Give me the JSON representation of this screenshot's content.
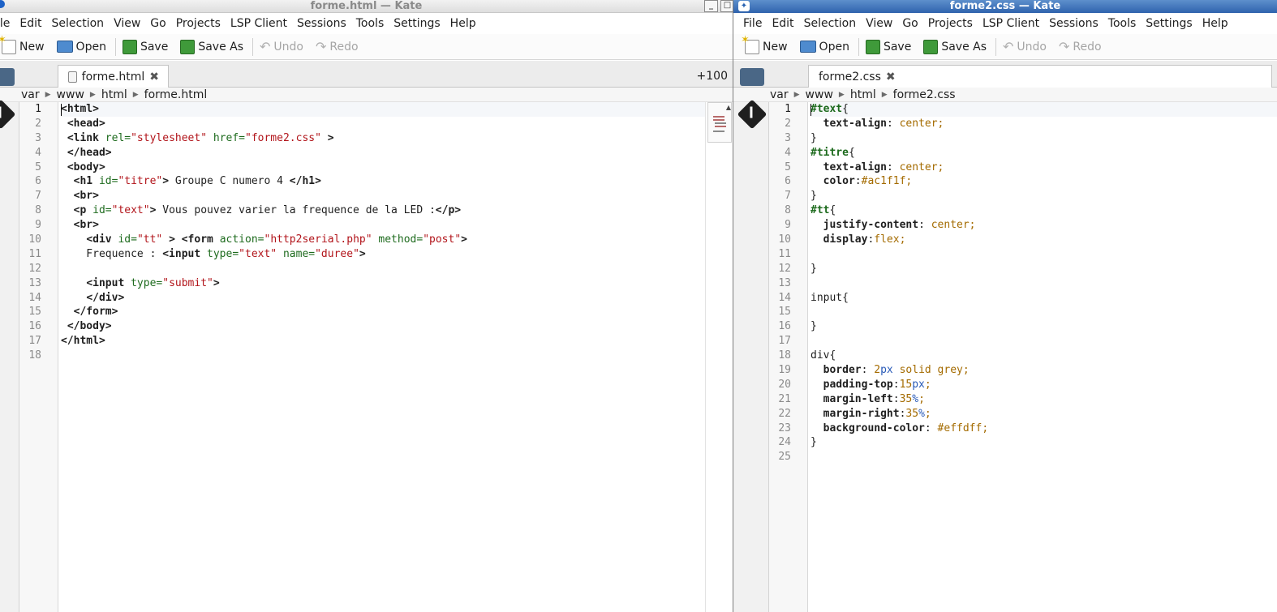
{
  "colors": {
    "tag": "#1f1f1f",
    "attr": "#1e6b1e",
    "string": "#b2151b",
    "value": "#a46b00",
    "number": "#2a5bb8",
    "selector": "#1e6b1e"
  },
  "left": {
    "title": "forme.html  — Kate",
    "menu": [
      "ile",
      "Edit",
      "Selection",
      "View",
      "Go",
      "Projects",
      "LSP Client",
      "Sessions",
      "Tools",
      "Settings",
      "Help"
    ],
    "toolbar": {
      "new": "New",
      "open": "Open",
      "save": "Save",
      "save_as": "Save As",
      "undo": "Undo",
      "redo": "Redo"
    },
    "tab": {
      "label": "forme.html",
      "close": "✖"
    },
    "zoom": "+100",
    "breadcrumb": [
      "var",
      "www",
      "html",
      "forme.html"
    ],
    "lines": [
      {
        "n": "1",
        "segs": [
          {
            "t": "<html>",
            "c": "tag"
          }
        ]
      },
      {
        "n": "2",
        "segs": [
          {
            "t": " "
          },
          {
            "t": "<head>",
            "c": "tag"
          }
        ]
      },
      {
        "n": "3",
        "segs": [
          {
            "t": " "
          },
          {
            "t": "<link",
            "c": "tag"
          },
          {
            "t": " "
          },
          {
            "t": "rel=",
            "c": "attr"
          },
          {
            "t": "\"stylesheet\"",
            "c": "string"
          },
          {
            "t": " "
          },
          {
            "t": "href=",
            "c": "attr"
          },
          {
            "t": "\"forme2.css\"",
            "c": "string"
          },
          {
            "t": " "
          },
          {
            "t": ">",
            "c": "tag"
          }
        ]
      },
      {
        "n": "4",
        "segs": [
          {
            "t": " "
          },
          {
            "t": "</head>",
            "c": "tag"
          }
        ]
      },
      {
        "n": "5",
        "segs": [
          {
            "t": " "
          },
          {
            "t": "<body>",
            "c": "tag"
          }
        ]
      },
      {
        "n": "6",
        "segs": [
          {
            "t": "  "
          },
          {
            "t": "<h1",
            "c": "tag"
          },
          {
            "t": " "
          },
          {
            "t": "id=",
            "c": "attr"
          },
          {
            "t": "\"titre\"",
            "c": "string"
          },
          {
            "t": ">",
            "c": "tag"
          },
          {
            "t": " Groupe C numero 4 "
          },
          {
            "t": "</h1>",
            "c": "tag"
          }
        ]
      },
      {
        "n": "7",
        "segs": [
          {
            "t": "  "
          },
          {
            "t": "<br>",
            "c": "tag"
          }
        ]
      },
      {
        "n": "8",
        "segs": [
          {
            "t": "  "
          },
          {
            "t": "<p",
            "c": "tag"
          },
          {
            "t": " "
          },
          {
            "t": "id=",
            "c": "attr"
          },
          {
            "t": "\"text\"",
            "c": "string"
          },
          {
            "t": ">",
            "c": "tag"
          },
          {
            "t": " Vous pouvez varier la frequence de la LED :"
          },
          {
            "t": "</p>",
            "c": "tag"
          }
        ]
      },
      {
        "n": "9",
        "segs": [
          {
            "t": "  "
          },
          {
            "t": "<br>",
            "c": "tag"
          }
        ]
      },
      {
        "n": "10",
        "segs": [
          {
            "t": "    "
          },
          {
            "t": "<div",
            "c": "tag"
          },
          {
            "t": " "
          },
          {
            "t": "id=",
            "c": "attr"
          },
          {
            "t": "\"tt\"",
            "c": "string"
          },
          {
            "t": " "
          },
          {
            "t": ">",
            "c": "tag"
          },
          {
            "t": " "
          },
          {
            "t": "<form",
            "c": "tag"
          },
          {
            "t": " "
          },
          {
            "t": "action=",
            "c": "attr"
          },
          {
            "t": "\"http2serial.php\"",
            "c": "string"
          },
          {
            "t": " "
          },
          {
            "t": "method=",
            "c": "attr"
          },
          {
            "t": "\"post\"",
            "c": "string"
          },
          {
            "t": ">",
            "c": "tag"
          }
        ]
      },
      {
        "n": "11",
        "segs": [
          {
            "t": "    Frequence : "
          },
          {
            "t": "<input",
            "c": "tag"
          },
          {
            "t": " "
          },
          {
            "t": "type=",
            "c": "attr"
          },
          {
            "t": "\"text\"",
            "c": "string"
          },
          {
            "t": " "
          },
          {
            "t": "name=",
            "c": "attr"
          },
          {
            "t": "\"duree\"",
            "c": "string"
          },
          {
            "t": ">",
            "c": "tag"
          }
        ]
      },
      {
        "n": "12",
        "segs": []
      },
      {
        "n": "13",
        "segs": [
          {
            "t": "    "
          },
          {
            "t": "<input",
            "c": "tag"
          },
          {
            "t": " "
          },
          {
            "t": "type=",
            "c": "attr"
          },
          {
            "t": "\"submit\"",
            "c": "string"
          },
          {
            "t": ">",
            "c": "tag"
          }
        ]
      },
      {
        "n": "14",
        "segs": [
          {
            "t": "    "
          },
          {
            "t": "</div>",
            "c": "tag"
          }
        ]
      },
      {
        "n": "15",
        "segs": [
          {
            "t": "  "
          },
          {
            "t": "</form>",
            "c": "tag"
          }
        ]
      },
      {
        "n": "16",
        "segs": [
          {
            "t": " "
          },
          {
            "t": "</body>",
            "c": "tag"
          }
        ]
      },
      {
        "n": "17",
        "segs": [
          {
            "t": "</html>",
            "c": "tag"
          }
        ]
      },
      {
        "n": "18",
        "segs": []
      }
    ]
  },
  "right": {
    "title": "forme2.css  — Kate",
    "menu": [
      "File",
      "Edit",
      "Selection",
      "View",
      "Go",
      "Projects",
      "LSP Client",
      "Sessions",
      "Tools",
      "Settings",
      "Help"
    ],
    "toolbar": {
      "new": "New",
      "open": "Open",
      "save": "Save",
      "save_as": "Save As",
      "undo": "Undo",
      "redo": "Redo"
    },
    "tab": {
      "label": "forme2.css",
      "close": "✖"
    },
    "breadcrumb": [
      "var",
      "www",
      "html",
      "forme2.css"
    ],
    "lines": [
      {
        "n": "1",
        "segs": [
          {
            "t": "#text",
            "c": "selector"
          },
          {
            "t": "{"
          }
        ]
      },
      {
        "n": "2",
        "segs": [
          {
            "t": "  "
          },
          {
            "t": "text-align",
            "c": "tag"
          },
          {
            "t": ": "
          },
          {
            "t": "center;",
            "c": "value"
          }
        ]
      },
      {
        "n": "3",
        "segs": [
          {
            "t": "}"
          }
        ]
      },
      {
        "n": "4",
        "segs": [
          {
            "t": "#titre",
            "c": "selector"
          },
          {
            "t": "{"
          }
        ]
      },
      {
        "n": "5",
        "segs": [
          {
            "t": "  "
          },
          {
            "t": "text-align",
            "c": "tag"
          },
          {
            "t": ": "
          },
          {
            "t": "center;",
            "c": "value"
          }
        ]
      },
      {
        "n": "6",
        "segs": [
          {
            "t": "  "
          },
          {
            "t": "color",
            "c": "tag"
          },
          {
            "t": ":"
          },
          {
            "t": "#ac1f1f;",
            "c": "value"
          }
        ]
      },
      {
        "n": "7",
        "segs": [
          {
            "t": "}"
          }
        ]
      },
      {
        "n": "8",
        "segs": [
          {
            "t": "#tt",
            "c": "selector"
          },
          {
            "t": "{"
          }
        ]
      },
      {
        "n": "9",
        "segs": [
          {
            "t": "  "
          },
          {
            "t": "justify-content",
            "c": "tag"
          },
          {
            "t": ": "
          },
          {
            "t": "center;",
            "c": "value"
          }
        ]
      },
      {
        "n": "10",
        "segs": [
          {
            "t": "  "
          },
          {
            "t": "display",
            "c": "tag"
          },
          {
            "t": ":"
          },
          {
            "t": "flex;",
            "c": "value"
          }
        ]
      },
      {
        "n": "11",
        "segs": []
      },
      {
        "n": "12",
        "segs": [
          {
            "t": "}"
          }
        ]
      },
      {
        "n": "13",
        "segs": []
      },
      {
        "n": "14",
        "segs": [
          {
            "t": "input{"
          }
        ]
      },
      {
        "n": "15",
        "segs": []
      },
      {
        "n": "16",
        "segs": [
          {
            "t": "}"
          }
        ]
      },
      {
        "n": "17",
        "segs": []
      },
      {
        "n": "18",
        "segs": [
          {
            "t": "div{"
          }
        ]
      },
      {
        "n": "19",
        "segs": [
          {
            "t": "  "
          },
          {
            "t": "border",
            "c": "tag"
          },
          {
            "t": ": "
          },
          {
            "t": "2",
            "c": "value"
          },
          {
            "t": "px",
            "c": "number"
          },
          {
            "t": " solid grey;",
            "c": "value"
          }
        ]
      },
      {
        "n": "20",
        "segs": [
          {
            "t": "  "
          },
          {
            "t": "padding-top",
            "c": "tag"
          },
          {
            "t": ":"
          },
          {
            "t": "15",
            "c": "value"
          },
          {
            "t": "px",
            "c": "number"
          },
          {
            "t": ";",
            "c": "value"
          }
        ]
      },
      {
        "n": "21",
        "segs": [
          {
            "t": "  "
          },
          {
            "t": "margin-left",
            "c": "tag"
          },
          {
            "t": ":"
          },
          {
            "t": "35",
            "c": "value"
          },
          {
            "t": "%",
            "c": "number"
          },
          {
            "t": ";",
            "c": "value"
          }
        ]
      },
      {
        "n": "22",
        "segs": [
          {
            "t": "  "
          },
          {
            "t": "margin-right",
            "c": "tag"
          },
          {
            "t": ":"
          },
          {
            "t": "35",
            "c": "value"
          },
          {
            "t": "%",
            "c": "number"
          },
          {
            "t": ";",
            "c": "value"
          }
        ]
      },
      {
        "n": "23",
        "segs": [
          {
            "t": "  "
          },
          {
            "t": "background-color",
            "c": "tag"
          },
          {
            "t": ": "
          },
          {
            "t": "#effdff;",
            "c": "value"
          }
        ]
      },
      {
        "n": "24",
        "segs": [
          {
            "t": "}"
          }
        ]
      },
      {
        "n": "25",
        "segs": []
      }
    ]
  }
}
